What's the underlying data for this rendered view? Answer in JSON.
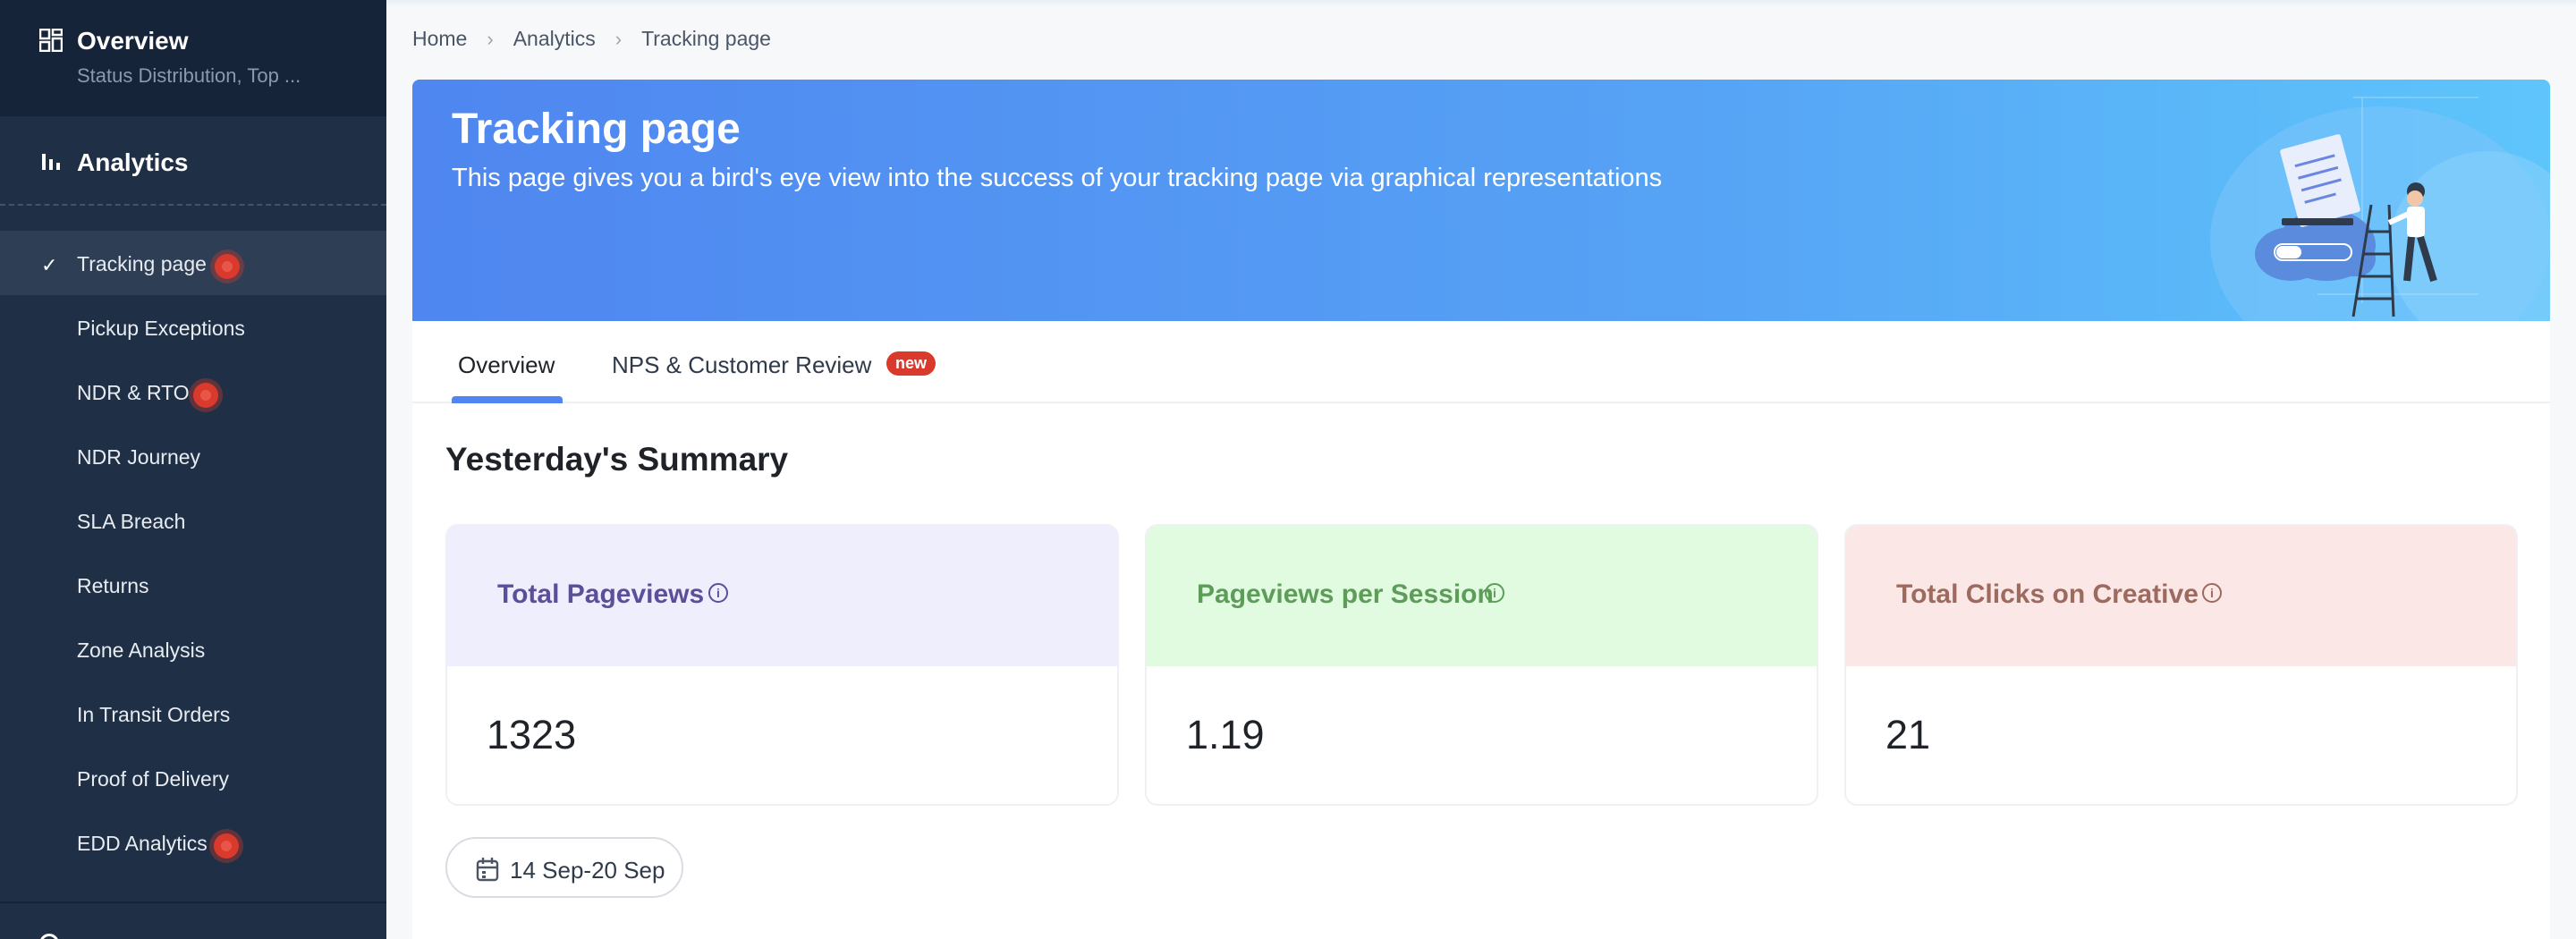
{
  "sidebar": {
    "overview_title": "Overview",
    "overview_sub": "Status Distribution, Top ...",
    "analytics_title": "Analytics",
    "items": [
      {
        "label": "Tracking page",
        "active": true,
        "dot": true
      },
      {
        "label": "Pickup Exceptions",
        "active": false,
        "dot": false
      },
      {
        "label": "NDR & RTO",
        "active": false,
        "dot": true
      },
      {
        "label": "NDR Journey",
        "active": false,
        "dot": false
      },
      {
        "label": "SLA Breach",
        "active": false,
        "dot": false
      },
      {
        "label": "Returns",
        "active": false,
        "dot": false
      },
      {
        "label": "Zone Analysis",
        "active": false,
        "dot": false
      },
      {
        "label": "In Transit Orders",
        "active": false,
        "dot": false
      },
      {
        "label": "Proof of Delivery",
        "active": false,
        "dot": false
      },
      {
        "label": "EDD Analytics",
        "active": false,
        "dot": true
      }
    ]
  },
  "breadcrumb": [
    "Home",
    "Analytics",
    "Tracking page"
  ],
  "banner": {
    "title": "Tracking page",
    "subtitle": "This page gives you a bird's eye view into the success of your tracking page via graphical representations"
  },
  "tabs": {
    "overview": "Overview",
    "nps": "NPS & Customer Review",
    "nps_badge": "new"
  },
  "summary": {
    "title": "Yesterday's Summary",
    "stats": [
      {
        "label": "Total Pageviews",
        "value": "1323"
      },
      {
        "label": "Pageviews per Session",
        "value": "1.19"
      },
      {
        "label": "Total Clicks on Creative",
        "value": "21"
      }
    ]
  },
  "date_range": "14 Sep-20 Sep",
  "colors": {
    "sidebar_bg": "#1f3046",
    "accent": "#4f86f0",
    "dot": "#d93a2c"
  }
}
